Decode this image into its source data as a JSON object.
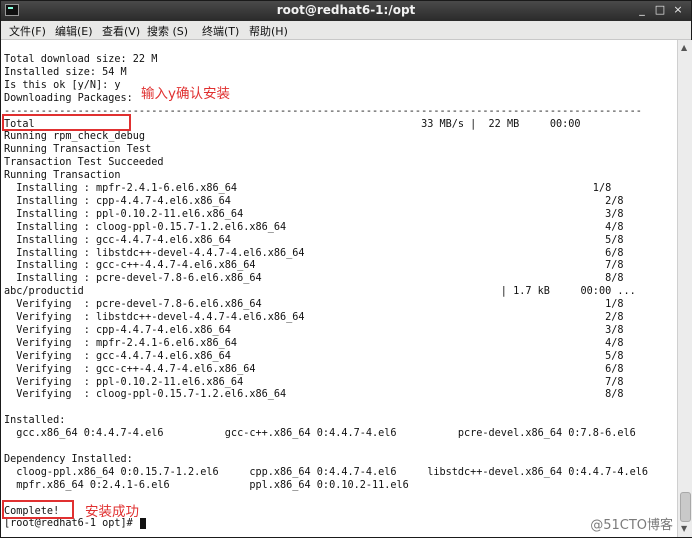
{
  "window": {
    "title": "root@redhat6-1:/opt",
    "controls": {
      "minimize": "_",
      "maximize": "□",
      "close": "×"
    }
  },
  "menu": {
    "items": [
      "文件(F)",
      "编辑(E)",
      "查看(V)",
      "搜索 (S)",
      "终端(T)",
      "帮助(H)"
    ]
  },
  "terminal": {
    "lines": [
      "Total download size: 22 M",
      "Installed size: 54 M",
      "Is this ok [y/N]: y",
      "Downloading Packages:",
      "--------------------------------------------------------------------------------------------------------",
      "Total                                                               33 MB/s |  22 MB     00:00",
      "Running rpm_check_debug",
      "Running Transaction Test",
      "Transaction Test Succeeded",
      "Running Transaction",
      "  Installing : mpfr-2.4.1-6.el6.x86_64                                                          1/8",
      "  Installing : cpp-4.4.7-4.el6.x86_64                                                             2/8",
      "  Installing : ppl-0.10.2-11.el6.x86_64                                                           3/8",
      "  Installing : cloog-ppl-0.15.7-1.2.el6.x86_64                                                    4/8",
      "  Installing : gcc-4.4.7-4.el6.x86_64                                                             5/8",
      "  Installing : libstdc++-devel-4.4.7-4.el6.x86_64                                                 6/8",
      "  Installing : gcc-c++-4.4.7-4.el6.x86_64                                                         7/8",
      "  Installing : pcre-devel-7.8-6.el6.x86_64                                                        8/8",
      "abc/productid                                                                    | 1.7 kB     00:00 ...",
      "  Verifying  : pcre-devel-7.8-6.el6.x86_64                                                        1/8",
      "  Verifying  : libstdc++-devel-4.4.7-4.el6.x86_64                                                 2/8",
      "  Verifying  : cpp-4.4.7-4.el6.x86_64                                                             3/8",
      "  Verifying  : mpfr-2.4.1-6.el6.x86_64                                                            4/8",
      "  Verifying  : gcc-4.4.7-4.el6.x86_64                                                             5/8",
      "  Verifying  : gcc-c++-4.4.7-4.el6.x86_64                                                         6/8",
      "  Verifying  : ppl-0.10.2-11.el6.x86_64                                                           7/8",
      "  Verifying  : cloog-ppl-0.15.7-1.2.el6.x86_64                                                    8/8",
      "",
      "Installed:",
      "  gcc.x86_64 0:4.4.7-4.el6          gcc-c++.x86_64 0:4.4.7-4.el6          pcre-devel.x86_64 0:7.8-6.el6",
      "",
      "Dependency Installed:",
      "  cloog-ppl.x86_64 0:0.15.7-1.2.el6     cpp.x86_64 0:4.4.7-4.el6     libstdc++-devel.x86_64 0:4.4.7-4.el6",
      "  mpfr.x86_64 0:2.4.1-6.el6             ppl.x86_64 0:0.10.2-11.el6",
      "",
      "Complete!",
      "[root@redhat6-1 opt]# "
    ]
  },
  "annotations": {
    "confirm": "输入y确认安装",
    "success": "安装成功"
  },
  "watermark": "@51CTO博客",
  "colors": {
    "annotation": "#e03030",
    "titlebar": "#2e2e2e",
    "terminal_bg": "#ffffff"
  }
}
